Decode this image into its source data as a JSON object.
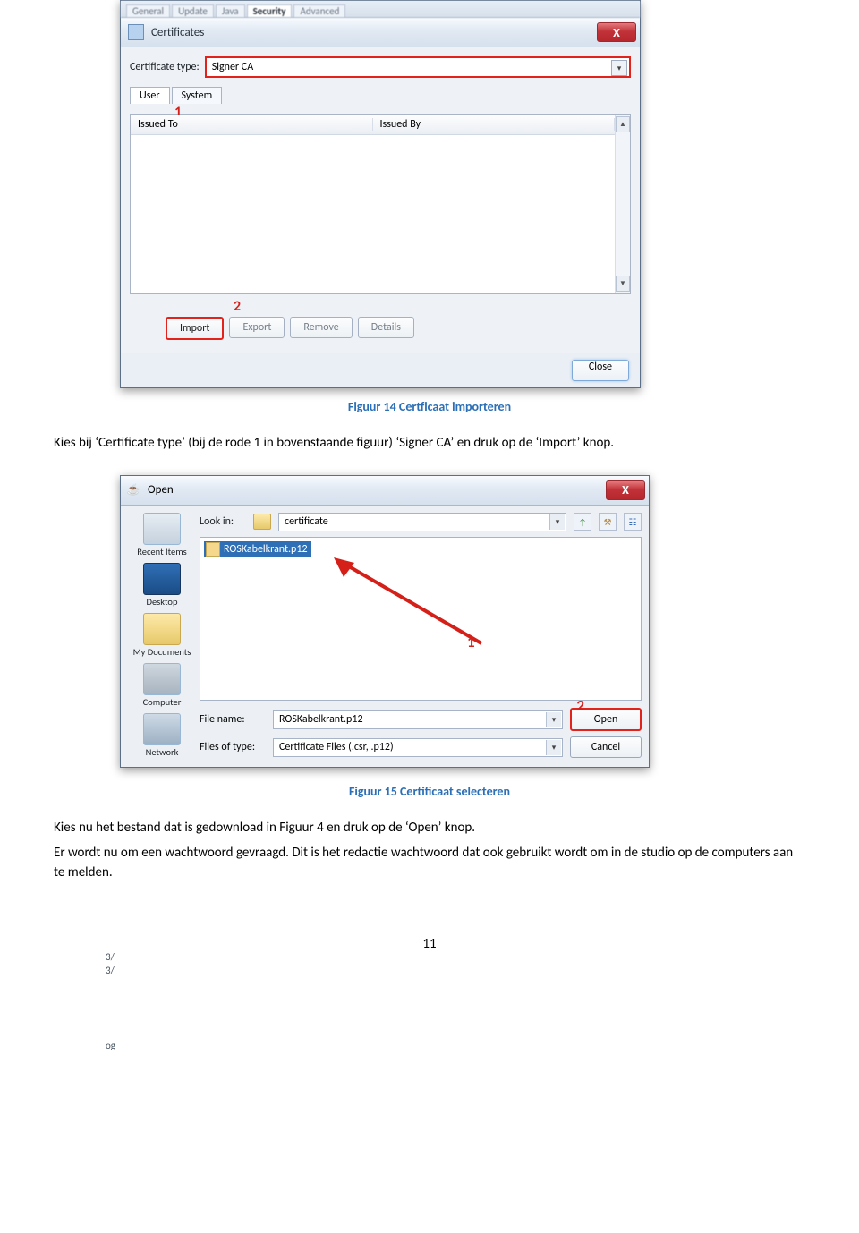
{
  "cert_dialog": {
    "title": "Certificates",
    "top_tabs": [
      "General",
      "Update",
      "Java",
      "Security",
      "Advanced"
    ],
    "cert_type_label": "Certificate type:",
    "cert_type_value": "Signer CA",
    "sub_tabs": {
      "user": "User",
      "system": "System"
    },
    "annot1": "1",
    "list_cols": {
      "issued_to": "Issued To",
      "issued_by": "Issued By"
    },
    "annot2": "2",
    "buttons": {
      "import": "Import",
      "export": "Export",
      "remove": "Remove",
      "details": "Details"
    },
    "close": "Close",
    "close_x": "X"
  },
  "caption14": "Figuur 14 Certficaat importeren",
  "para1": "Kies bij ‘Certificate type’ (bij de rode 1 in bovenstaande figuur) ‘Signer CA’ en druk op de ‘Import’ knop.",
  "open_dialog": {
    "title": "Open",
    "java_icon": "☕",
    "close_x": "X",
    "look_in_label": "Look in:",
    "look_in_value": "certificate",
    "tool_up": "↑",
    "tool_new": "⚒",
    "tool_view": "☷",
    "places": {
      "recent": "Recent Items",
      "desktop": "Desktop",
      "documents": "My Documents",
      "computer": "Computer",
      "network": "Network"
    },
    "file_item": "ROSKabelkrant.p12",
    "annot1": "1",
    "annot2": "2",
    "filename_label": "File name:",
    "filename_value": "ROSKabelkrant.p12",
    "filetype_label": "Files of type:",
    "filetype_value": "Certificate Files (.csr, .p12)",
    "open_btn": "Open",
    "cancel_btn": "Cancel"
  },
  "left_slivers": {
    "l1": "3/",
    "l2": "3/",
    "l3": "og"
  },
  "caption15": "Figuur 15 Certificaat selecteren",
  "para2": "Kies nu het bestand dat is gedownload in Figuur 4 en druk op de ‘Open’ knop.",
  "para3": "Er wordt nu om een wachtwoord gevraagd. Dit is het redactie wachtwoord dat ook gebruikt wordt om in de studio op de computers aan te melden.",
  "pagenum": "11"
}
